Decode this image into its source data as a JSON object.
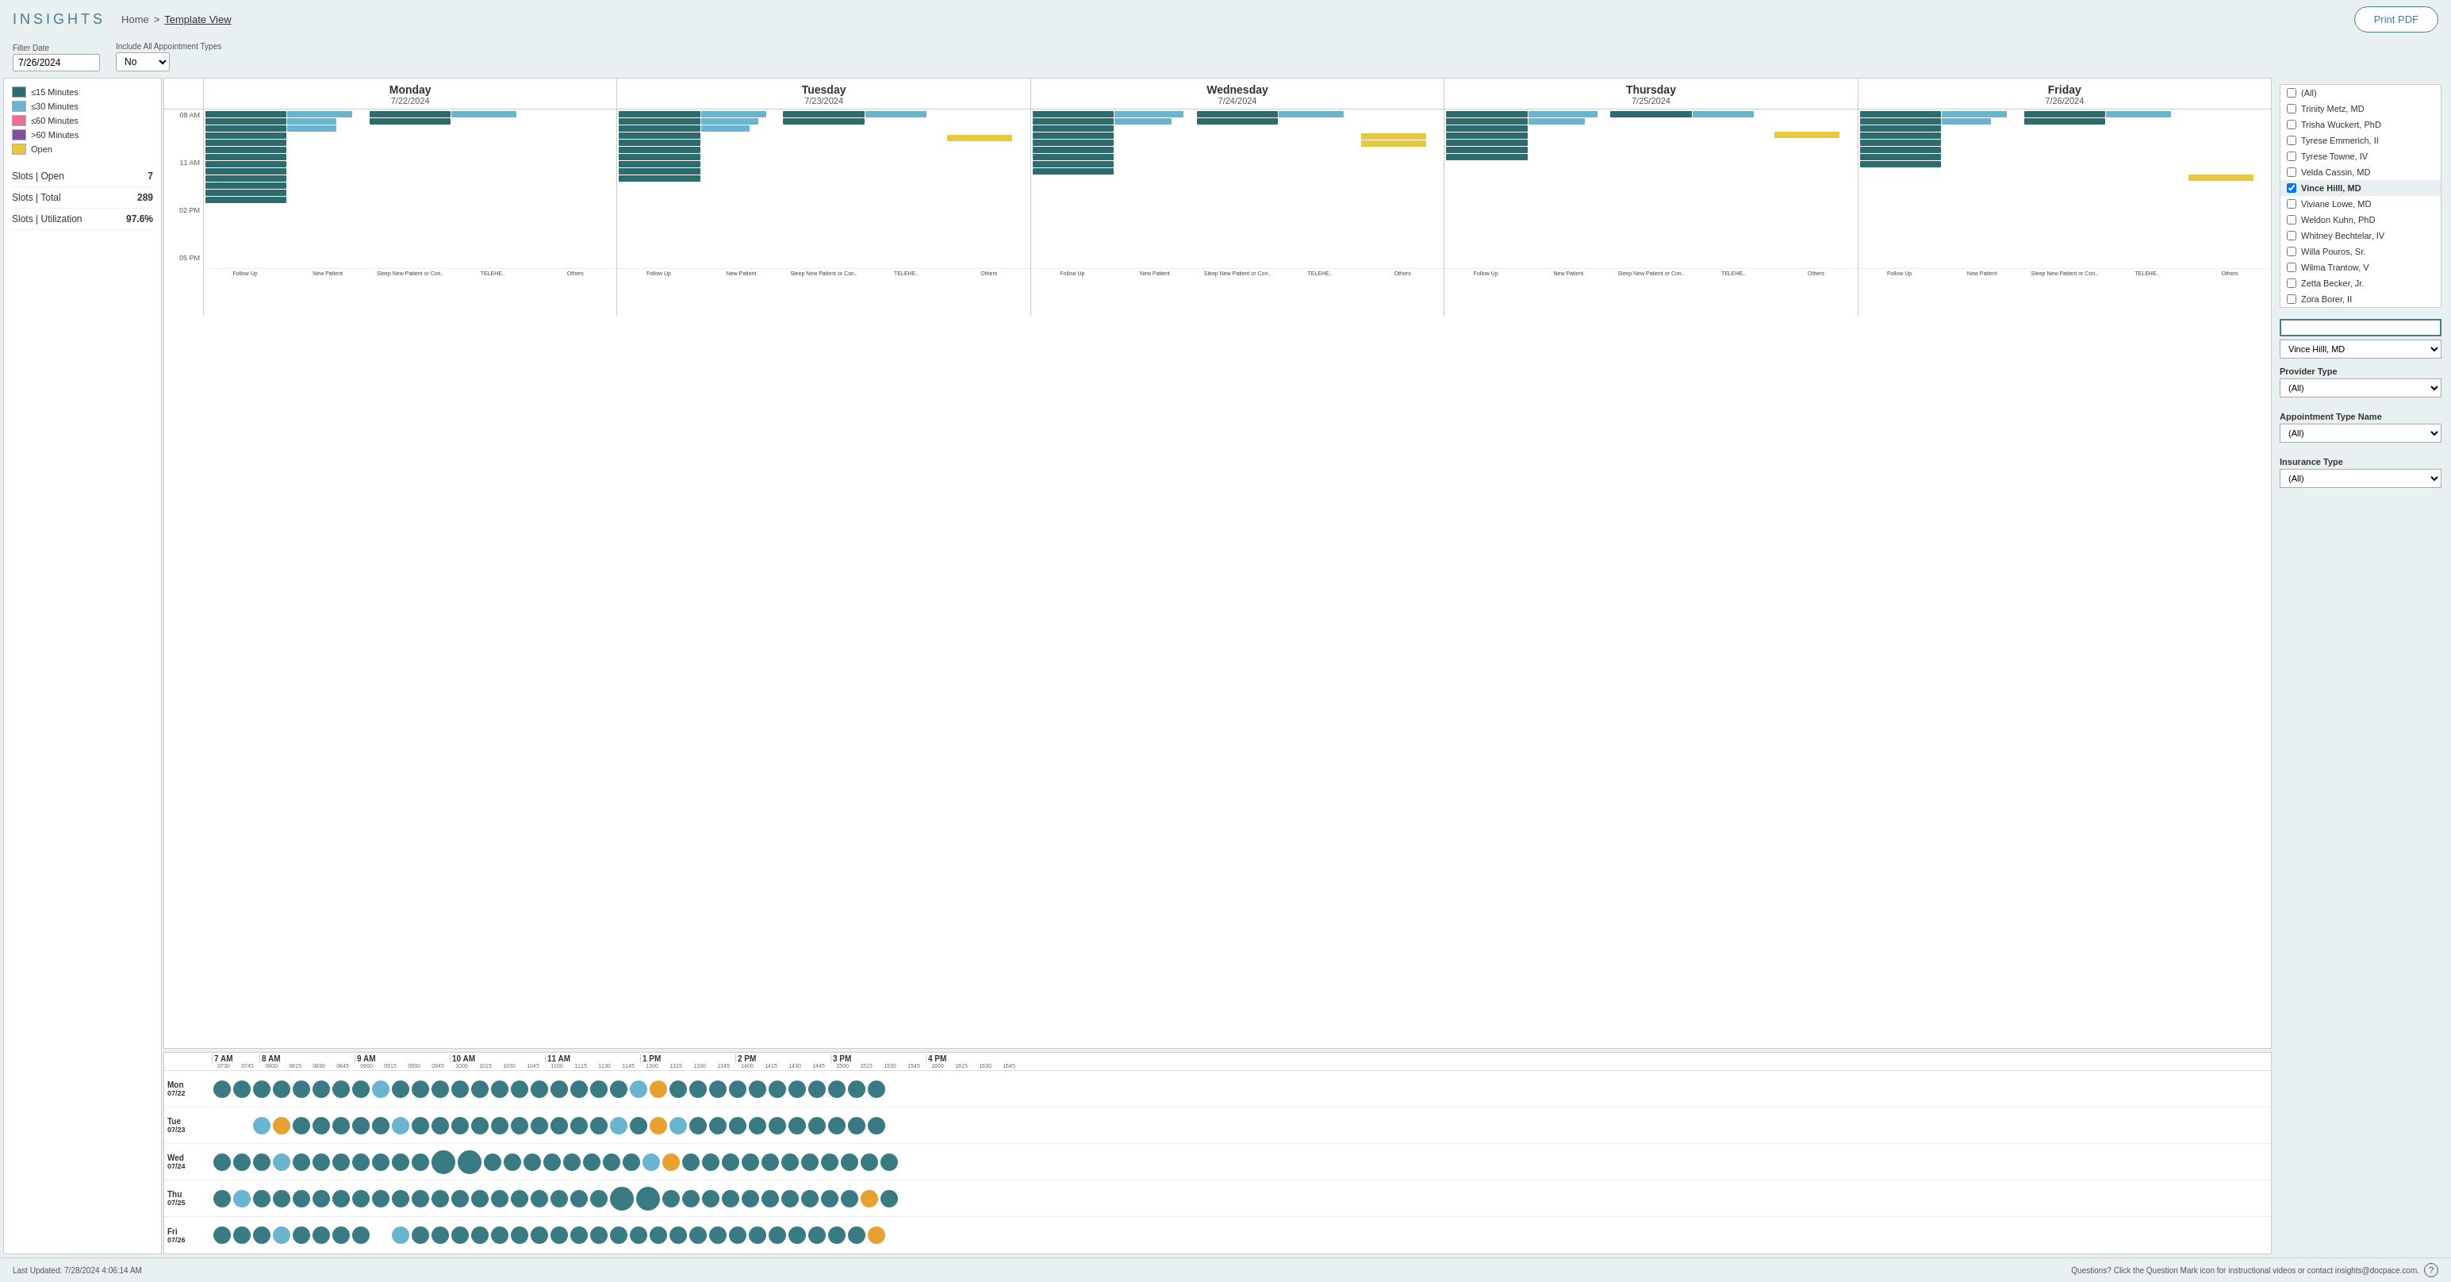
{
  "app": {
    "logo": "INSIGHTS",
    "breadcrumb_home": "Home",
    "breadcrumb_separator": ">",
    "breadcrumb_current": "Template View",
    "print_button": "Print PDF"
  },
  "filters": {
    "filter_date_label": "Filter Date",
    "filter_date_value": "7/26/2024",
    "appt_types_label": "Include All Appointment Types",
    "appt_types_value": "No"
  },
  "legend": {
    "items": [
      {
        "label": "<=15 Minutes",
        "color": "#2d6b6e"
      },
      {
        "label": "<=30 Minutes",
        "color": "#6ab4d0"
      },
      {
        "label": "<=60 Minutes",
        "color": "#e87090"
      },
      {
        "label": ">60 Minutes",
        "color": "#8050a0"
      },
      {
        "label": "Open",
        "color": "#e8c840"
      }
    ]
  },
  "stats": [
    {
      "label": "Slots | Open",
      "value": "7"
    },
    {
      "label": "Slots | Total",
      "value": "289"
    },
    {
      "label": "Slots | Utilization",
      "value": "97.6%"
    }
  ],
  "days": [
    {
      "name": "Monday",
      "date": "7/22/2024",
      "short": "Mon",
      "short_date": "07/22"
    },
    {
      "name": "Tuesday",
      "date": "7/23/2024",
      "short": "Tue",
      "short_date": "07/23"
    },
    {
      "name": "Wednesday",
      "date": "7/24/2024",
      "short": "Wed",
      "short_date": "07/24"
    },
    {
      "name": "Thursday",
      "date": "7/25/2024",
      "short": "Thu",
      "short_date": "07/25"
    },
    {
      "name": "Friday",
      "date": "7/26/2024",
      "short": "Fri",
      "short_date": "07/26"
    }
  ],
  "appt_types": [
    "Follow Up",
    "New Patient",
    "Sleep New Patient or Con..",
    "TELEHE..",
    "Others"
  ],
  "time_labels": [
    "08 AM",
    "11 AM",
    "02 PM",
    "05 PM"
  ],
  "dot_grid": {
    "time_majors": [
      "7 AM",
      "8 AM",
      "9 AM",
      "10 AM",
      "11 AM",
      "1 PM",
      "2 PM",
      "3 PM",
      "4 PM"
    ],
    "time_minors": [
      "0730",
      "0745",
      "0800",
      "0815",
      "0830",
      "0845",
      "0900",
      "0915",
      "0930",
      "0945",
      "1000",
      "1015",
      "1030",
      "1045",
      "1100",
      "1115",
      "1130",
      "1145",
      "1300",
      "1315",
      "1330",
      "1345",
      "1400",
      "1415",
      "1430",
      "1445",
      "1500",
      "1515",
      "1530",
      "1545",
      "1600",
      "1615",
      "1630",
      "1645"
    ]
  },
  "providers": [
    {
      "label": "(All)",
      "checked": false
    },
    {
      "label": "Trinity Metz, MD",
      "checked": false
    },
    {
      "label": "Trisha Wuckert, PhD",
      "checked": false
    },
    {
      "label": "Tyrese Emmerich, II",
      "checked": false
    },
    {
      "label": "Tyrese Towne, IV",
      "checked": false
    },
    {
      "label": "Velda Cassin, MD",
      "checked": false
    },
    {
      "label": "Vince Hilll, MD",
      "checked": true
    },
    {
      "label": "Viviane Lowe, MD",
      "checked": false
    },
    {
      "label": "Weldon Kuhn, PhD",
      "checked": false
    },
    {
      "label": "Whitney Bechtelar, IV",
      "checked": false
    },
    {
      "label": "Willa Pouros, Sr.",
      "checked": false
    },
    {
      "label": "Wilma Trantow, V",
      "checked": false
    },
    {
      "label": "Zetta Becker, Jr.",
      "checked": false
    },
    {
      "label": "Zora Borer, II",
      "checked": false
    }
  ],
  "sidebar": {
    "search_placeholder": "",
    "selected_provider": "Vince Hilll, MD",
    "provider_type_label": "Provider Type",
    "provider_type_value": "(All)",
    "appt_type_label": "Appointment Type Name",
    "appt_type_value": "(All)",
    "insurance_label": "Insurance Type",
    "insurance_value": "(All)"
  },
  "footer": {
    "last_updated": "Last Updated: 7/28/2024 4:06:14 AM",
    "help_text": "Questions? Click the Question Mark icon for instructional videos or contact insights@docpace.com.",
    "help_icon": "?"
  }
}
